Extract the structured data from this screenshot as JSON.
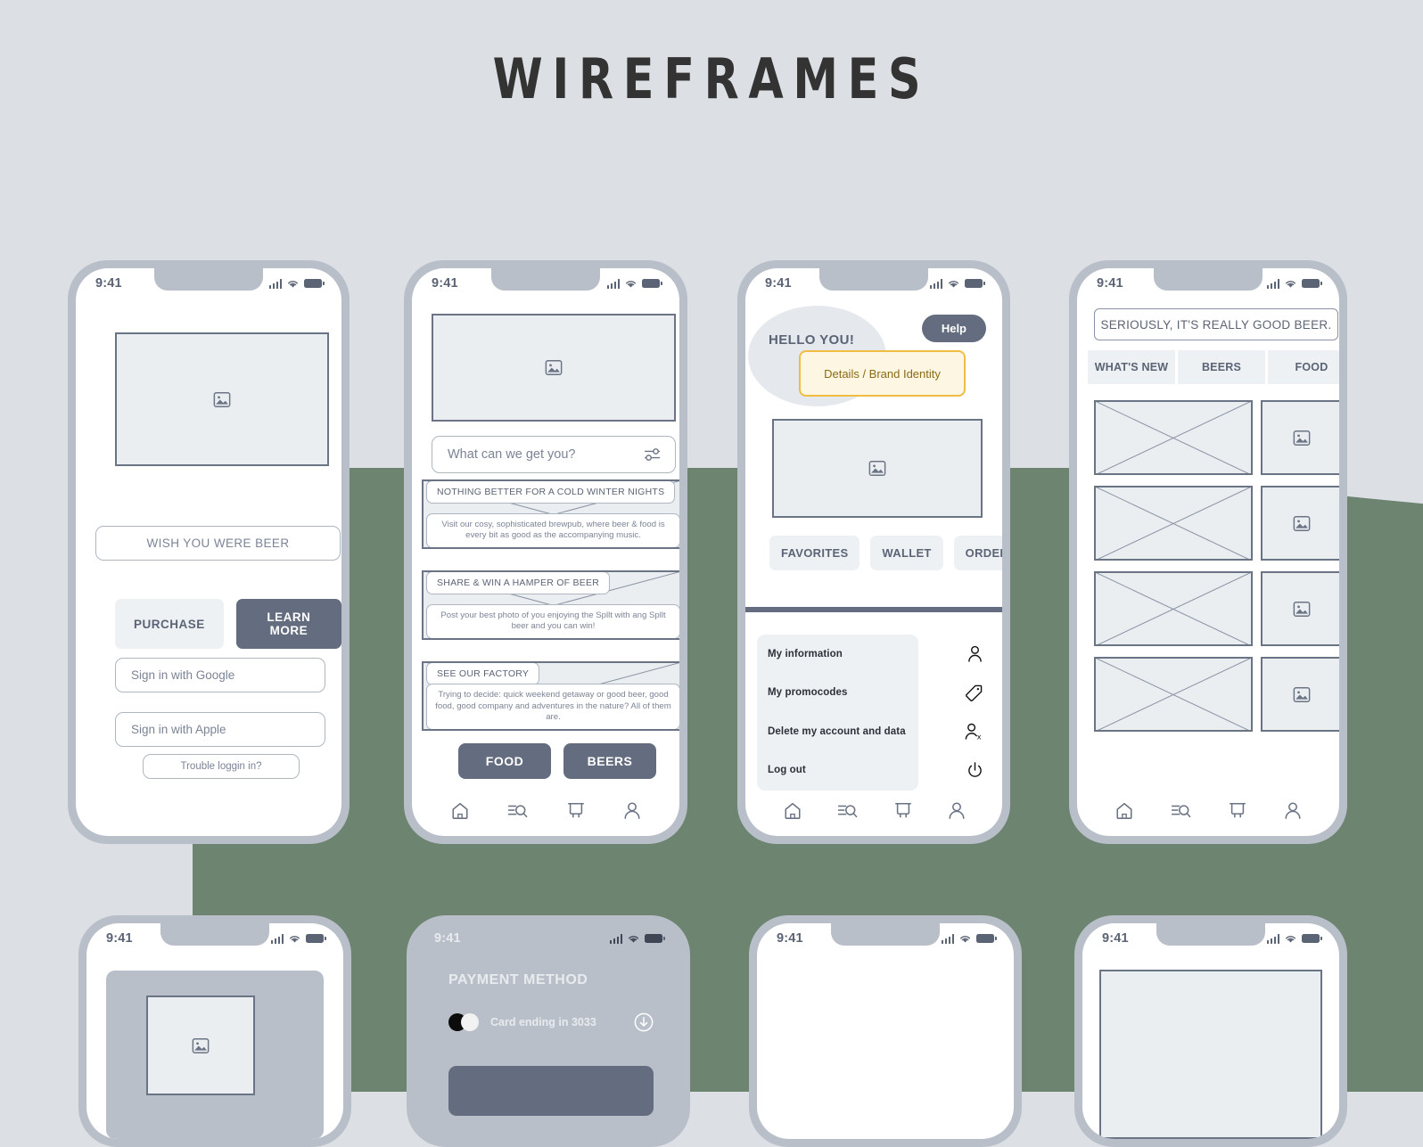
{
  "page": {
    "title": "WIREFRAMES",
    "background_color": "#dcdfe3",
    "accent_green": "#6d8471",
    "accent_yellow": "#f0bd42",
    "dark_slate": "#646d7f"
  },
  "status_bar": {
    "time": "9:41"
  },
  "screen1": {
    "name": "login",
    "tagline": "WISH YOU WERE BEER",
    "purchase_label": "PURCHASE",
    "learn_more_label": "LEARN MORE",
    "google_label": "Sign in with Google",
    "apple_label": "Sign in with Apple",
    "trouble_label": "Trouble loggin in?"
  },
  "screen2": {
    "name": "home-feed",
    "search_placeholder": "What can we get you?",
    "cards": [
      {
        "title": "NOTHING BETTER FOR A COLD WINTER NIGHTS",
        "desc": "Visit our cosy, sophisticated brewpub, where beer & food is every bit as good as the accompanying music."
      },
      {
        "title": "SHARE & WIN A HAMPER OF BEER",
        "desc": "Post your best photo of you enjoying the Spllt with ang Spllt beer and you can win!"
      },
      {
        "title": "SEE OUR FACTORY",
        "desc": "Trying to decide: quick weekend getaway or good beer, good food, good company and adventures in the nature? All of them are."
      }
    ],
    "food_label": "FOOD",
    "beers_label": "BEERS"
  },
  "screen3": {
    "name": "account",
    "greeting": "HELLO YOU!",
    "help_label": "Help",
    "brand_note": "Details / Brand Identity",
    "chips": [
      "FAVORITES",
      "WALLET",
      "ORDERS"
    ],
    "menu": [
      {
        "label": "My information",
        "icon": "person-icon"
      },
      {
        "label": "My promocodes",
        "icon": "tag-icon"
      },
      {
        "label": "Delete my account and data",
        "icon": "person-remove-icon"
      },
      {
        "label": "Log out",
        "icon": "power-icon"
      }
    ]
  },
  "screen4": {
    "name": "catalogue",
    "banner": "SERIOUSLY, IT'S REALLY GOOD BEER.",
    "tabs": [
      "WHAT'S NEW",
      "BEERS",
      "FOOD"
    ],
    "grid_rows": 4
  },
  "screen5": {
    "name": "product-detail"
  },
  "screen6": {
    "name": "payment-method",
    "title": "PAYMENT METHOD",
    "card_label": "Card ending in 3033",
    "download_icon": "download-circle-icon"
  },
  "screen7": {
    "name": "blank"
  },
  "screen8": {
    "name": "media-view"
  },
  "bottom_nav": [
    {
      "icon": "home-icon"
    },
    {
      "icon": "search-list-icon"
    },
    {
      "icon": "cart-icon"
    },
    {
      "icon": "person-icon"
    }
  ]
}
